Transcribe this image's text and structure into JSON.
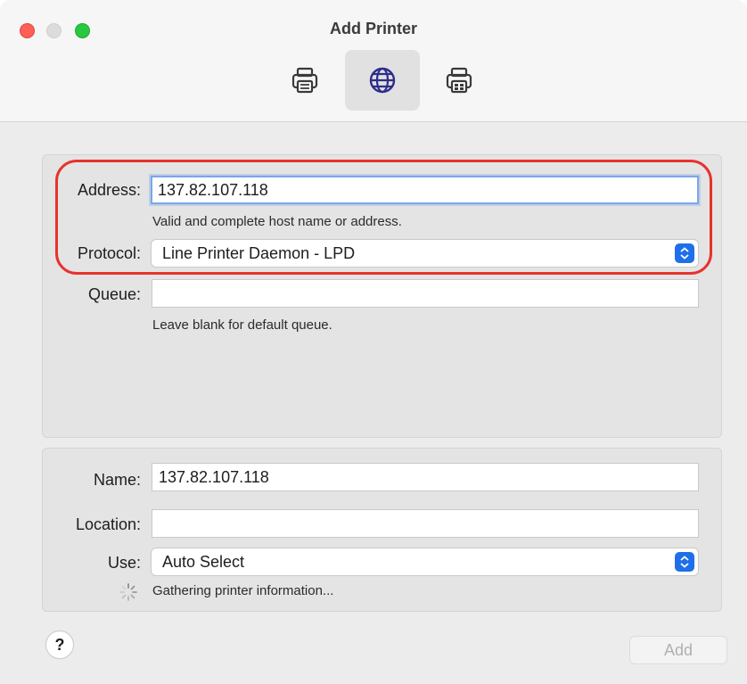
{
  "window": {
    "title": "Add Printer"
  },
  "toolbar": {
    "items": [
      {
        "icon": "printer-icon",
        "selected": false
      },
      {
        "icon": "globe-icon",
        "selected": true
      },
      {
        "icon": "windows-printer-icon",
        "selected": false
      }
    ]
  },
  "ip_panel": {
    "address_label": "Address:",
    "address_value": "137.82.107.118",
    "address_hint": "Valid and complete host name or address.",
    "protocol_label": "Protocol:",
    "protocol_value": "Line Printer Daemon - LPD",
    "queue_label": "Queue:",
    "queue_value": "",
    "queue_hint": "Leave blank for default queue."
  },
  "info_panel": {
    "name_label": "Name:",
    "name_value": "137.82.107.118",
    "location_label": "Location:",
    "location_value": "",
    "use_label": "Use:",
    "use_value": "Auto Select",
    "status_text": "Gathering printer information..."
  },
  "footer": {
    "help_label": "?",
    "add_label": "Add"
  },
  "colors": {
    "highlight": "#e8322d",
    "accent": "#1f6fe8",
    "close": "#fe5f57",
    "maximize": "#28c840"
  }
}
